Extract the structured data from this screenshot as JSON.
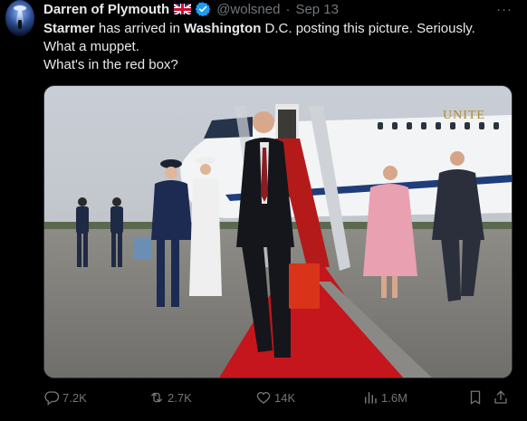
{
  "tweet": {
    "author_name": "Darren of Plymouth",
    "handle": "@wolsned",
    "separator": "·",
    "date": "Sep 13",
    "more_icon": "more-icon",
    "text_parts": {
      "p1_bold": "Starmer",
      "p1_rest": " has arrived in ",
      "p1_bold2": "Washington",
      "p1_end": " D.C. posting this picture. Seriously.",
      "line2": "What a muppet.",
      "line3": "What's in the red box?"
    }
  },
  "photo": {
    "aircraft_lettering": "UNITE"
  },
  "actions": {
    "replies": "7.2K",
    "reposts": "2.7K",
    "likes": "14K",
    "views": "1.6M"
  },
  "colors": {
    "background": "#000000",
    "text": "#e7e9ea",
    "muted": "#71767b",
    "verified": "#1d9bf0",
    "carpet": "#c4161c",
    "red_box": "#d9331a"
  }
}
